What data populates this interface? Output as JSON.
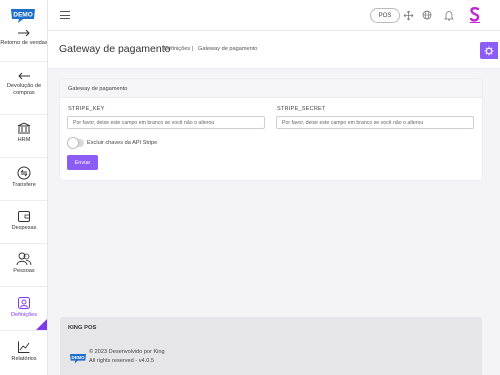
{
  "sidebar": {
    "logo_text": "DEMO",
    "items": [
      {
        "label": "Retorno de vendas",
        "icon": "arrow-right-icon"
      },
      {
        "label": "Devolução de compras",
        "icon": "arrow-left-icon"
      },
      {
        "label": "HRM",
        "icon": "bank-icon"
      },
      {
        "label": "Transfere",
        "icon": "transfer-icon"
      },
      {
        "label": "Despesas",
        "icon": "wallet-icon"
      },
      {
        "label": "Pessoas",
        "icon": "people-icon"
      },
      {
        "label": "Definições",
        "icon": "settings-icon"
      },
      {
        "label": "Relatórios",
        "icon": "chart-icon"
      }
    ],
    "active_item": "Definições"
  },
  "topbar": {
    "pos_label": "POS",
    "icons": [
      "menu-icon",
      "fullscreen-icon",
      "globe-icon",
      "bell-icon",
      "brand-logo"
    ]
  },
  "header": {
    "title": "Gateway de pagamento",
    "breadcrumb_1": "Definições",
    "breadcrumb_sep": "|",
    "breadcrumb_2": "Gateway de pagamento"
  },
  "card": {
    "heading": "Gateway de pagamento",
    "stripe_key_label": "STRIPE_KEY",
    "stripe_key_placeholder": "Por favor, deixe este campo em branco se você não o alterou",
    "stripe_secret_label": "STRIPE_SECRET",
    "stripe_secret_placeholder": "Por favor, deixe este campo em branco se você não o alterou",
    "delete_keys_label": "Excluir chaves da API Stripe",
    "delete_keys_checked": false,
    "submit_label": "Enviar"
  },
  "footer": {
    "title": "KING POS",
    "copyright": "© 2023 Desenvolvido por King",
    "rights": "All rights reserved - v4.0.5"
  },
  "colors": {
    "accent": "#8b5cf6",
    "logo_blue": "#1f6fc9",
    "brand_magenta": "#c026d3"
  }
}
